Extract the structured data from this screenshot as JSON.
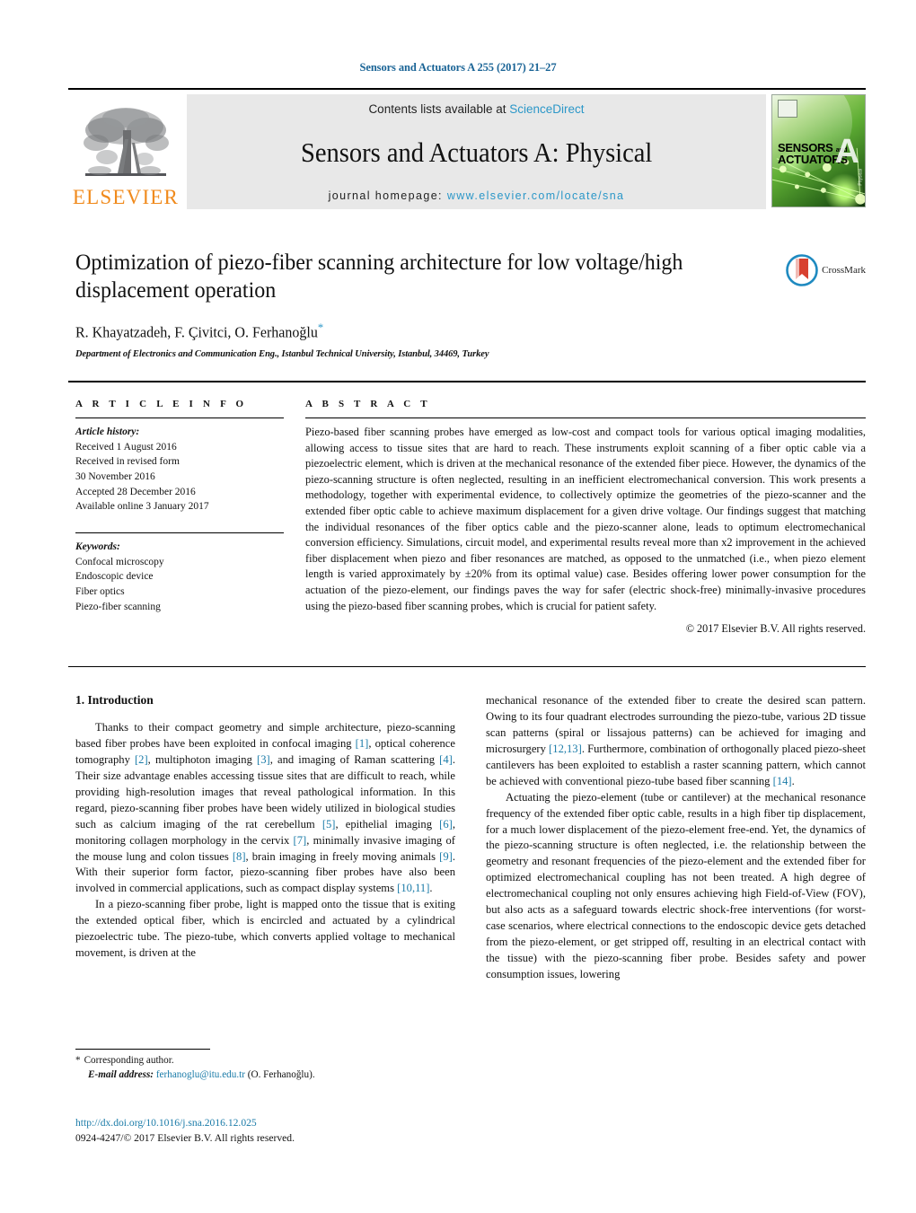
{
  "running_head": "Sensors and Actuators A 255 (2017) 21–27",
  "masthead": {
    "publisher_logo_text": "ELSEVIER",
    "contents_prefix": "Contents lists available at ",
    "contents_link": "ScienceDirect",
    "journal_title": "Sensors and Actuators A: Physical",
    "homepage_prefix": "journal homepage: ",
    "homepage_url": "www.elsevier.com/locate/sna",
    "cover": {
      "line1": "SENSORS",
      "line1_small": "and",
      "line2": "ACTUATORS",
      "big_letter": "A",
      "sub_letter": "Physical"
    },
    "colors": {
      "link": "#2b97c8",
      "band": "#e8e8e8",
      "elsevier_orange": "#f08a1c"
    }
  },
  "article": {
    "title": "Optimization of piezo-fiber scanning architecture for low voltage/high displacement operation",
    "authors": "R. Khayatzadeh, F. Çivitci, O. Ferhanoğlu",
    "corresponding_marker": "*",
    "affiliation": "Department of Electronics and Communication Eng., Istanbul Technical University, Istanbul, 34469, Turkey",
    "crossmark_label": "CrossMark"
  },
  "article_info": {
    "heading": "A R T I C L E   I N F O",
    "history_label": "Article history:",
    "history": [
      "Received 1 August 2016",
      "Received in revised form",
      "30 November 2016",
      "Accepted 28 December 2016",
      "Available online 3 January 2017"
    ],
    "keywords_label": "Keywords:",
    "keywords": [
      "Confocal microscopy",
      "Endoscopic device",
      "Fiber optics",
      "Piezo-fiber scanning"
    ]
  },
  "abstract": {
    "heading": "A B S T R A C T",
    "text": "Piezo-based fiber scanning probes have emerged as low-cost and compact tools for various optical imaging modalities, allowing access to tissue sites that are hard to reach. These instruments exploit scanning of a fiber optic cable via a piezoelectric element, which is driven at the mechanical resonance of the extended fiber piece. However, the dynamics of the piezo-scanning structure is often neglected, resulting in an inefficient electromechanical conversion. This work presents a methodology, together with experimental evidence, to collectively optimize the geometries of the piezo-scanner and the extended fiber optic cable to achieve maximum displacement for a given drive voltage. Our findings suggest that matching the individual resonances of the fiber optics cable and the piezo-scanner alone, leads to optimum electromechanical conversion efficiency. Simulations, circuit model, and experimental results reveal more than x2 improvement in the achieved fiber displacement when piezo and fiber resonances are matched, as opposed to the unmatched (i.e., when piezo element length is varied approximately by ±20% from its optimal value) case. Besides offering lower power consumption for the actuation of the piezo-element, our findings paves the way for safer (electric shock-free) minimally-invasive procedures using the piezo-based fiber scanning probes, which is crucial for patient safety.",
    "copyright": "© 2017 Elsevier B.V. All rights reserved."
  },
  "body": {
    "section_number_title": "1.  Introduction",
    "left_paragraphs": [
      "Thanks to their compact geometry and simple architecture, piezo-scanning based fiber probes have been exploited in confocal imaging [1], optical coherence tomography [2], multiphoton imaging [3], and imaging of Raman scattering [4]. Their size advantage enables accessing tissue sites that are difficult to reach, while providing high-resolution images that reveal pathological information. In this regard, piezo-scanning fiber probes have been widely utilized in biological studies such as calcium imaging of the rat cerebellum [5], epithelial imaging [6], monitoring collagen morphology in the cervix [7], minimally invasive imaging of the mouse lung and colon tissues [8], brain imaging in freely moving animals [9]. With their superior form factor, piezo-scanning fiber probes have also been involved in commercial applications, such as compact display systems [10,11].",
      "In a piezo-scanning fiber probe, light is mapped onto the tissue that is exiting the extended optical fiber, which is encircled and actuated by a cylindrical piezoelectric tube. The piezo-tube, which converts applied voltage to mechanical movement, is driven at the"
    ],
    "right_paragraphs": [
      "mechanical resonance of the extended fiber to create the desired scan pattern. Owing to its four quadrant electrodes surrounding the piezo-tube, various 2D tissue scan patterns (spiral or lissajous patterns) can be achieved for imaging and microsurgery [12,13]. Furthermore, combination of orthogonally placed piezo-sheet cantilevers has been exploited to establish a raster scanning pattern, which cannot be achieved with conventional piezo-tube based fiber scanning [14].",
      "Actuating the piezo-element (tube or cantilever) at the mechanical resonance frequency of the extended fiber optic cable, results in a high fiber tip displacement, for a much lower displacement of the piezo-element free-end. Yet, the dynamics of the piezo-scanning structure is often neglected, i.e. the relationship between the geometry and resonant frequencies of the piezo-element and the extended fiber for optimized electromechanical coupling has not been treated. A high degree of electromechanical coupling not only ensures achieving high Field-of-View (FOV), but also acts as a safeguard towards electric shock-free interventions (for worst-case scenarios, where electrical connections to the endoscopic device gets detached from the piezo-element, or get stripped off, resulting in an electrical contact with the tissue) with the piezo-scanning fiber probe. Besides safety and power consumption issues, lowering"
    ],
    "reference_link_color": "#1a7ba8"
  },
  "footer": {
    "corresponding_marker": "*",
    "corresponding_label": "Corresponding author.",
    "email_label": "E-mail address:",
    "email": "ferhanoglu@itu.edu.tr",
    "email_owner": "(O. Ferhanoğlu).",
    "doi_url": "http://dx.doi.org/10.1016/j.sna.2016.12.025",
    "issn_line": "0924-4247/© 2017 Elsevier B.V. All rights reserved."
  }
}
